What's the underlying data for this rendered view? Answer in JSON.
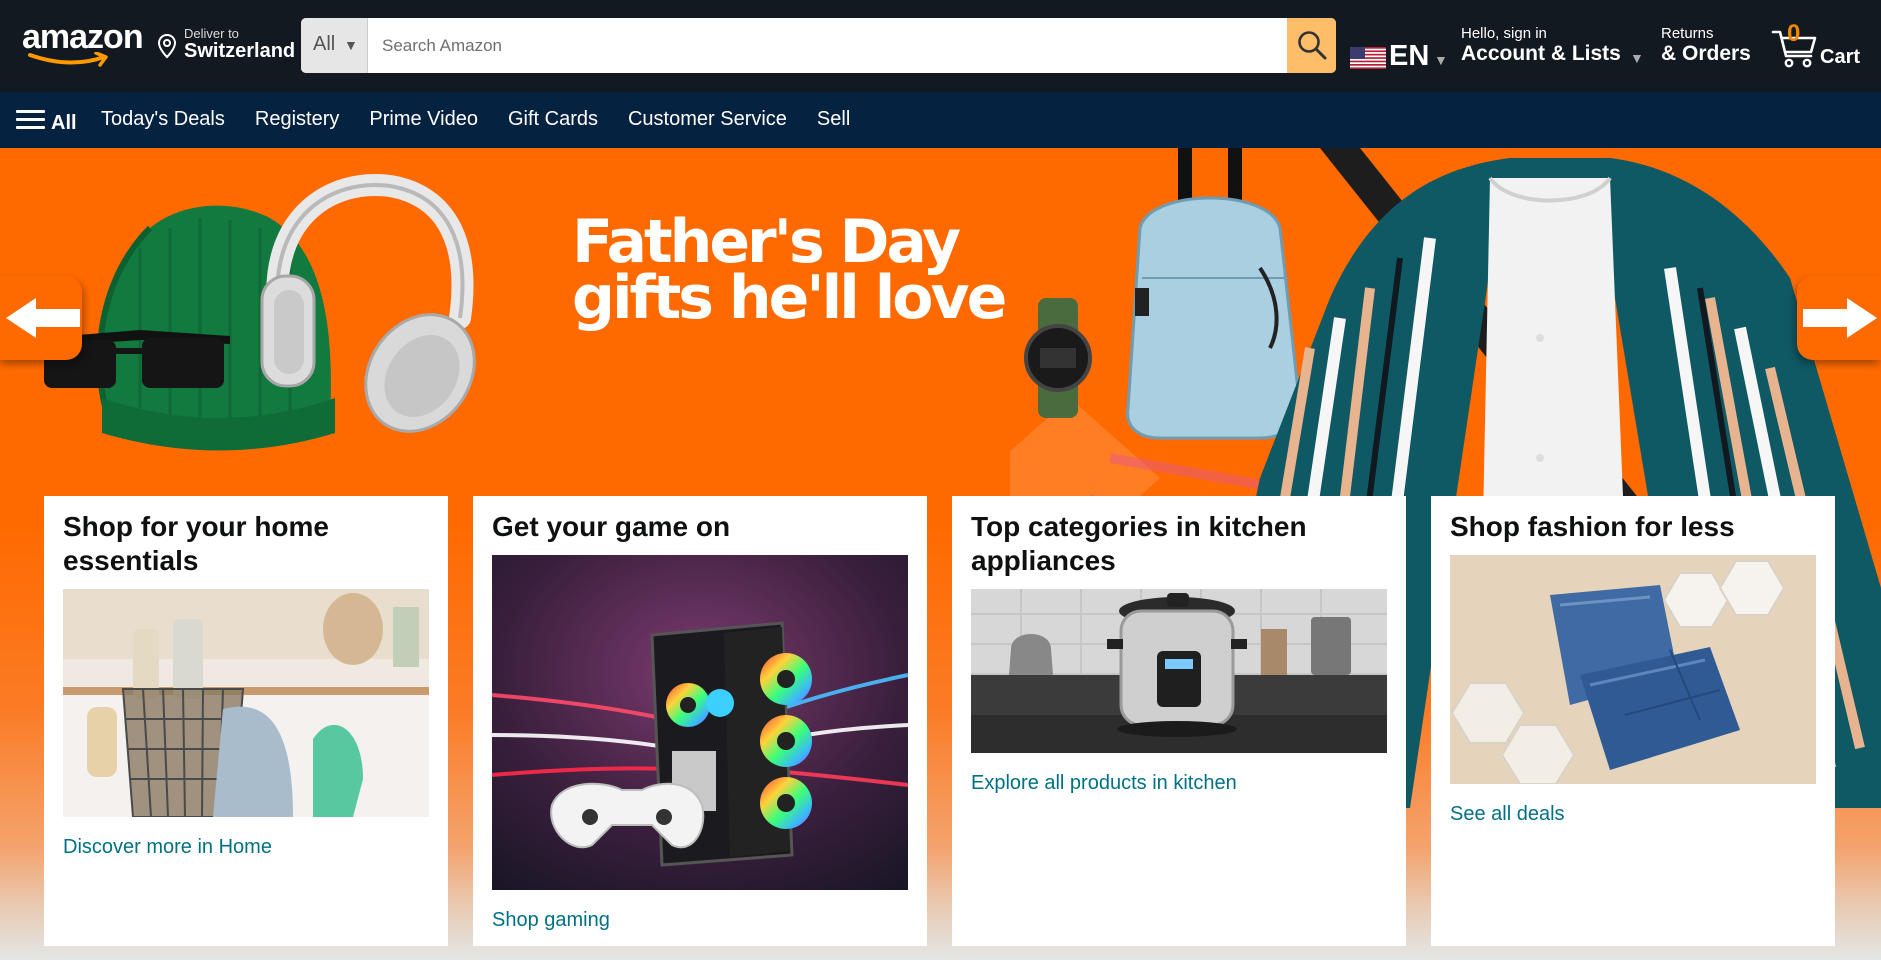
{
  "header": {
    "logo_text": "amazon",
    "deliver_line1": "Deliver to",
    "deliver_line2": "Switzerland",
    "search": {
      "category": "All",
      "placeholder": "Search Amazon",
      "value": ""
    },
    "language": "EN",
    "account_line1": "Hello, sign in",
    "account_line2": "Account & Lists",
    "orders_line1": "Returns",
    "orders_line2": "& Orders",
    "cart_count": "0",
    "cart_label": "Cart"
  },
  "nav": {
    "all_label": "All",
    "links": [
      "Today's Deals",
      "Registery",
      "Prime Video",
      "Gift Cards",
      "Customer Service",
      "Sell"
    ]
  },
  "hero": {
    "title_line1": "Father's Day",
    "title_line2": "gifts he'll love"
  },
  "cards": [
    {
      "title": "Shop for your home essentials",
      "link": "Discover more in Home"
    },
    {
      "title": "Get your game on",
      "link": "Shop gaming"
    },
    {
      "title": "Top categories in kitchen appliances",
      "link": "Explore all products in kitchen"
    },
    {
      "title": "Shop fashion for less",
      "link": "See all deals"
    }
  ],
  "colors": {
    "header_bg": "#131921",
    "nav_bg": "#052240",
    "hero_orange": "#ff6a00",
    "search_button": "#febd69",
    "link": "#007185",
    "cart_count": "#f08804"
  }
}
